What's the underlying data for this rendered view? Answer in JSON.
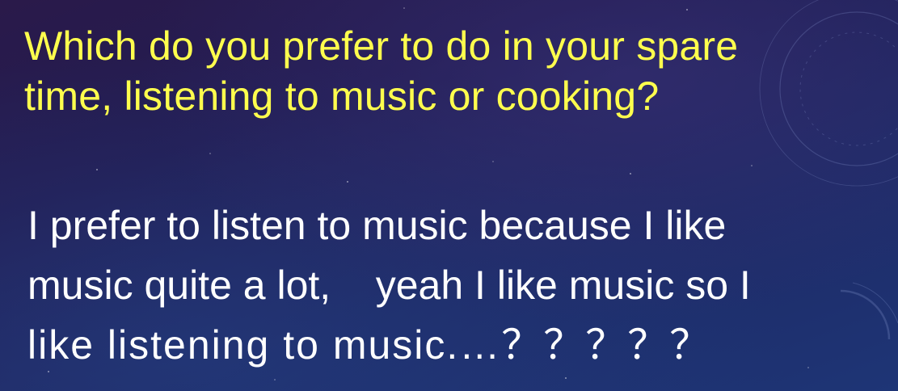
{
  "slide": {
    "question_lines": [
      "Which do you prefer to do in your spare",
      "time, listening to music or cooking?"
    ],
    "answer_lines": [
      "I prefer to listen to music because I like",
      "music quite a lot,    yeah I like music so I",
      "like listening to music.…？？？？？"
    ]
  },
  "colors": {
    "question_text": "#ffff4d",
    "answer_text": "#ffffff",
    "background": "#221c52"
  }
}
